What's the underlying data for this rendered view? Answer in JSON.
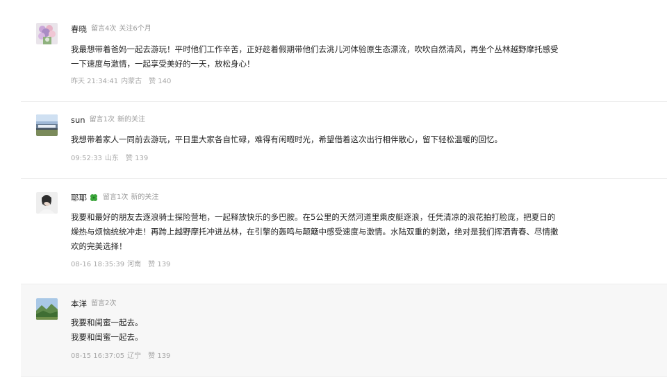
{
  "comments": [
    {
      "name": "春晓",
      "stats": [
        "留言4次",
        "关注6个月"
      ],
      "lines": [
        "我最想带着爸妈一起去游玩！平时他们工作辛苦，正好趁着假期带他们去洮儿河体验原生态漂流，吹吹自然清风，再坐个丛林越野摩托感受",
        "一下速度与激情，一起享受美好的一天，放松身心！"
      ],
      "time": "昨天 21:34:41",
      "region": "内蒙古",
      "likes": "赞 140"
    },
    {
      "name": "sun",
      "stats": [
        "留言1次",
        "新的关注"
      ],
      "lines": [
        "我想带着家人一同前去游玩，平日里大家各自忙碌，难得有闲暇时光，希望借着这次出行相伴散心，留下轻松温暖的回忆。"
      ],
      "time": "09:52:33",
      "region": "山东",
      "likes": "赞 139"
    },
    {
      "name": "耶耶",
      "badge_icon": "four-leaf-clover",
      "stats": [
        "留言1次",
        "新的关注"
      ],
      "lines": [
        "我要和最好的朋友去逐浪骑士探险营地，一起释放快乐的多巴胺。在5公里的天然河道里乘皮艇逐浪，任凭清凉的浪花拍打脸庞，把夏日的",
        "燥热与烦恼统统冲走！再跨上越野摩托冲进丛林，在引擎的轰鸣与颠簸中感受速度与激情。水陆双重的刺激，绝对是我们挥洒青春、尽情撒",
        "欢的完美选择！"
      ],
      "time": "08-16 18:35:39",
      "region": "河南",
      "likes": "赞 139"
    },
    {
      "name": "本洋",
      "stats": [
        "留言2次"
      ],
      "lines": [
        "我要和闺蜜一起去。",
        "我要和闺蜜一起去。"
      ],
      "time": "08-15 16:37:05",
      "region": "辽宁",
      "likes": "赞 139"
    }
  ],
  "colors": {
    "text": "#222222",
    "muted": "#9a9a9a",
    "divider": "#ececec",
    "highlight_bg": "#f7f7f7",
    "clover": "#3aa53a"
  }
}
